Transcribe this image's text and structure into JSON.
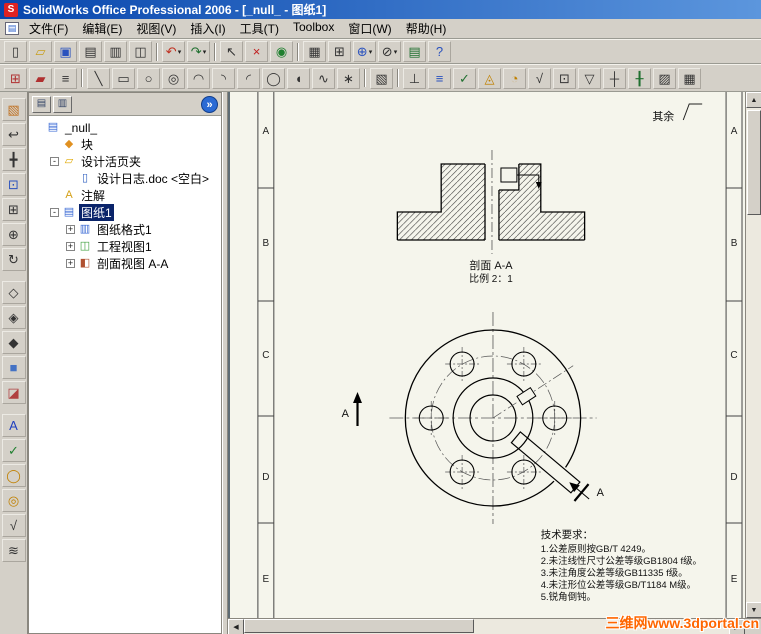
{
  "window": {
    "title": "SolidWorks Office Professional 2006 - [_null_ - 图纸1]",
    "logo": "S"
  },
  "menu": {
    "items": [
      {
        "name": "file",
        "label": "文件(F)"
      },
      {
        "name": "edit",
        "label": "编辑(E)"
      },
      {
        "name": "view",
        "label": "视图(V)"
      },
      {
        "name": "insert",
        "label": "插入(I)"
      },
      {
        "name": "tools",
        "label": "工具(T)"
      },
      {
        "name": "toolbox",
        "label": "Toolbox"
      },
      {
        "name": "window",
        "label": "窗口(W)"
      },
      {
        "name": "help",
        "label": "帮助(H)"
      }
    ]
  },
  "toolbar_standard": {
    "items": [
      {
        "name": "new-document",
        "glyph": "▯"
      },
      {
        "name": "open",
        "glyph": "▱",
        "color": "#c8a020"
      },
      {
        "name": "save",
        "glyph": "▣",
        "color": "#2a52be"
      },
      {
        "name": "make-drawing-from-part",
        "glyph": "▤"
      },
      {
        "name": "print",
        "glyph": "▥"
      },
      {
        "name": "print-preview",
        "glyph": "◫"
      },
      {
        "sep": true
      },
      {
        "name": "undo",
        "glyph": "↶",
        "color": "#c03020",
        "dropdown": true
      },
      {
        "name": "redo",
        "glyph": "↷",
        "color": "#207030",
        "dropdown": true
      },
      {
        "sep": true
      },
      {
        "name": "select",
        "glyph": "↖"
      },
      {
        "name": "delete",
        "glyph": "×",
        "color": "#c02020"
      },
      {
        "name": "rebuild",
        "glyph": "◉",
        "color": "#208030"
      },
      {
        "sep": true
      },
      {
        "name": "edit-sheet-format",
        "glyph": "▦"
      },
      {
        "name": "edit-table",
        "glyph": "⊞"
      },
      {
        "name": "zoom-tools",
        "glyph": "⊕",
        "color": "#2a52be",
        "dropdown": true
      },
      {
        "name": "hide-show-items",
        "glyph": "⊘",
        "dropdown": true
      },
      {
        "name": "view-notes",
        "glyph": "▤",
        "color": "#207030"
      },
      {
        "name": "help",
        "glyph": "?",
        "color": "#2a52be"
      }
    ]
  },
  "toolbar_sketch": {
    "items": [
      {
        "name": "sketch",
        "glyph": "⊞",
        "color": "#b03030"
      },
      {
        "name": "line-format",
        "glyph": "▰",
        "color": "#b03030"
      },
      {
        "name": "layer-properties",
        "glyph": "≡"
      },
      {
        "sep": true
      },
      {
        "name": "line",
        "glyph": "╲"
      },
      {
        "name": "rectangle",
        "glyph": "▭"
      },
      {
        "name": "circle",
        "glyph": "○"
      },
      {
        "name": "perimeter-circle",
        "glyph": "◎"
      },
      {
        "name": "centerpoint-arc",
        "glyph": "◠"
      },
      {
        "name": "tangent-arc",
        "glyph": "◝"
      },
      {
        "name": "three-point-arc",
        "glyph": "◜"
      },
      {
        "name": "ellipse",
        "glyph": "◯"
      },
      {
        "name": "partial-ellipse",
        "glyph": "◖"
      },
      {
        "name": "spline",
        "glyph": "∿"
      },
      {
        "name": "point",
        "glyph": "∗"
      },
      {
        "sep": true
      },
      {
        "name": "plane",
        "glyph": "▧"
      },
      {
        "sep": true
      },
      {
        "name": "smart-dimension",
        "glyph": "⊥"
      },
      {
        "name": "model-items",
        "glyph": "≡",
        "color": "#2a52be"
      },
      {
        "name": "spell-checker",
        "glyph": "✓",
        "color": "#207030"
      },
      {
        "name": "revision-symbol",
        "glyph": "◬",
        "color": "#c08000"
      },
      {
        "name": "balloon",
        "glyph": "◔",
        "color": "#c08000"
      },
      {
        "name": "surface-finish",
        "glyph": "√"
      },
      {
        "name": "geometric-tolerance",
        "glyph": "⊡"
      },
      {
        "name": "datum-feature",
        "glyph": "▽"
      },
      {
        "name": "center-mark",
        "glyph": "┼"
      },
      {
        "name": "centerline",
        "glyph": "╂",
        "color": "#207030"
      },
      {
        "name": "area-hatch",
        "glyph": "▨"
      },
      {
        "name": "table",
        "glyph": "▦"
      }
    ]
  },
  "left_toolbar": {
    "items": [
      {
        "name": "view-orientation",
        "glyph": "▧",
        "color": "#c07020"
      },
      {
        "name": "previous-view",
        "glyph": "↩"
      },
      {
        "name": "pan",
        "glyph": "╋"
      },
      {
        "name": "zoom-to-fit",
        "glyph": "⊡",
        "color": "#2a52be"
      },
      {
        "name": "zoom-to-area",
        "glyph": "⊞"
      },
      {
        "name": "zoom-in-out",
        "glyph": "⊕"
      },
      {
        "name": "rotate-view",
        "glyph": "↻"
      },
      {
        "gap": true
      },
      {
        "name": "wireframe",
        "glyph": "◇"
      },
      {
        "name": "hidden-lines-visible",
        "glyph": "◈"
      },
      {
        "name": "hidden-lines-removed",
        "glyph": "◆"
      },
      {
        "name": "shaded",
        "glyph": "■",
        "color": "#4472c4"
      },
      {
        "name": "section-view-display",
        "glyph": "◪",
        "color": "#b04040"
      },
      {
        "gap": true
      },
      {
        "name": "note",
        "glyph": "A",
        "color": "#2040c0"
      },
      {
        "name": "spell-checker",
        "glyph": "✓",
        "color": "#208030"
      },
      {
        "name": "balloon",
        "glyph": "◯",
        "color": "#c08000"
      },
      {
        "name": "stacked-balloon",
        "glyph": "◎",
        "color": "#c08000"
      },
      {
        "name": "surface-finish-symbol",
        "glyph": "√"
      },
      {
        "name": "weld-symbol",
        "glyph": "≋"
      }
    ]
  },
  "tree": {
    "tabs": [
      {
        "name": "featuremanager-tab",
        "glyph": "▤"
      },
      {
        "name": "propertymanager-tab",
        "glyph": "▥"
      }
    ],
    "chevron": "»",
    "items": [
      {
        "label": "_null_",
        "icon": "drawing-document",
        "glyph": "▤",
        "color": "#3a6ad4",
        "indent": 0
      },
      {
        "label": "块",
        "icon": "blocks-folder",
        "glyph": "◆",
        "color": "#e09020",
        "indent": 1
      },
      {
        "label": "设计活页夹",
        "icon": "design-binder-folder",
        "glyph": "▱",
        "color": "#e0a800",
        "indent": 1,
        "expand": "-"
      },
      {
        "label": "设计日志.doc <空白>",
        "icon": "design-journal-doc",
        "glyph": "▯",
        "color": "#3060c0",
        "indent": 2
      },
      {
        "label": "注解",
        "icon": "annotations-folder",
        "glyph": "A",
        "color": "#d4a017",
        "indent": 1
      },
      {
        "label": "图纸1",
        "icon": "sheet",
        "glyph": "▤",
        "color": "#3a6ad4",
        "indent": 1,
        "expand": "-",
        "selected": true
      },
      {
        "label": "图纸格式1",
        "icon": "sheet-format",
        "glyph": "▥",
        "color": "#3a6ad4",
        "indent": 2,
        "expand": "+"
      },
      {
        "label": "工程视图1",
        "icon": "drawing-view",
        "glyph": "◫",
        "color": "#40a040",
        "indent": 2,
        "expand": "+"
      },
      {
        "label": "剖面视图 A-A",
        "icon": "section-view",
        "glyph": "◧",
        "color": "#b05030",
        "indent": 2,
        "expand": "+"
      }
    ]
  },
  "drawing": {
    "zones": [
      "A",
      "B",
      "C",
      "D",
      "E"
    ],
    "section_label": "剖面 A-A",
    "scale_label": "比例 2：1",
    "other_note": "其余",
    "arrow_label": "A",
    "tech": {
      "title": "技术要求：",
      "lines": [
        "1.公差原则按GB/T 4249。",
        "2.未注线性尺寸公差等级GB1804 f级。",
        "3.未注角度公差等级GB11335 f级。",
        "4.未注形位公差等级GB/T1184 M级。",
        "5.锐角倒钝。"
      ]
    }
  },
  "scrollbars": {
    "up": "▲",
    "down": "▼",
    "left": "◀",
    "right": "▶"
  },
  "watermark": {
    "text": "三维网www.3dportal.cn",
    "color": "#ff6600"
  }
}
